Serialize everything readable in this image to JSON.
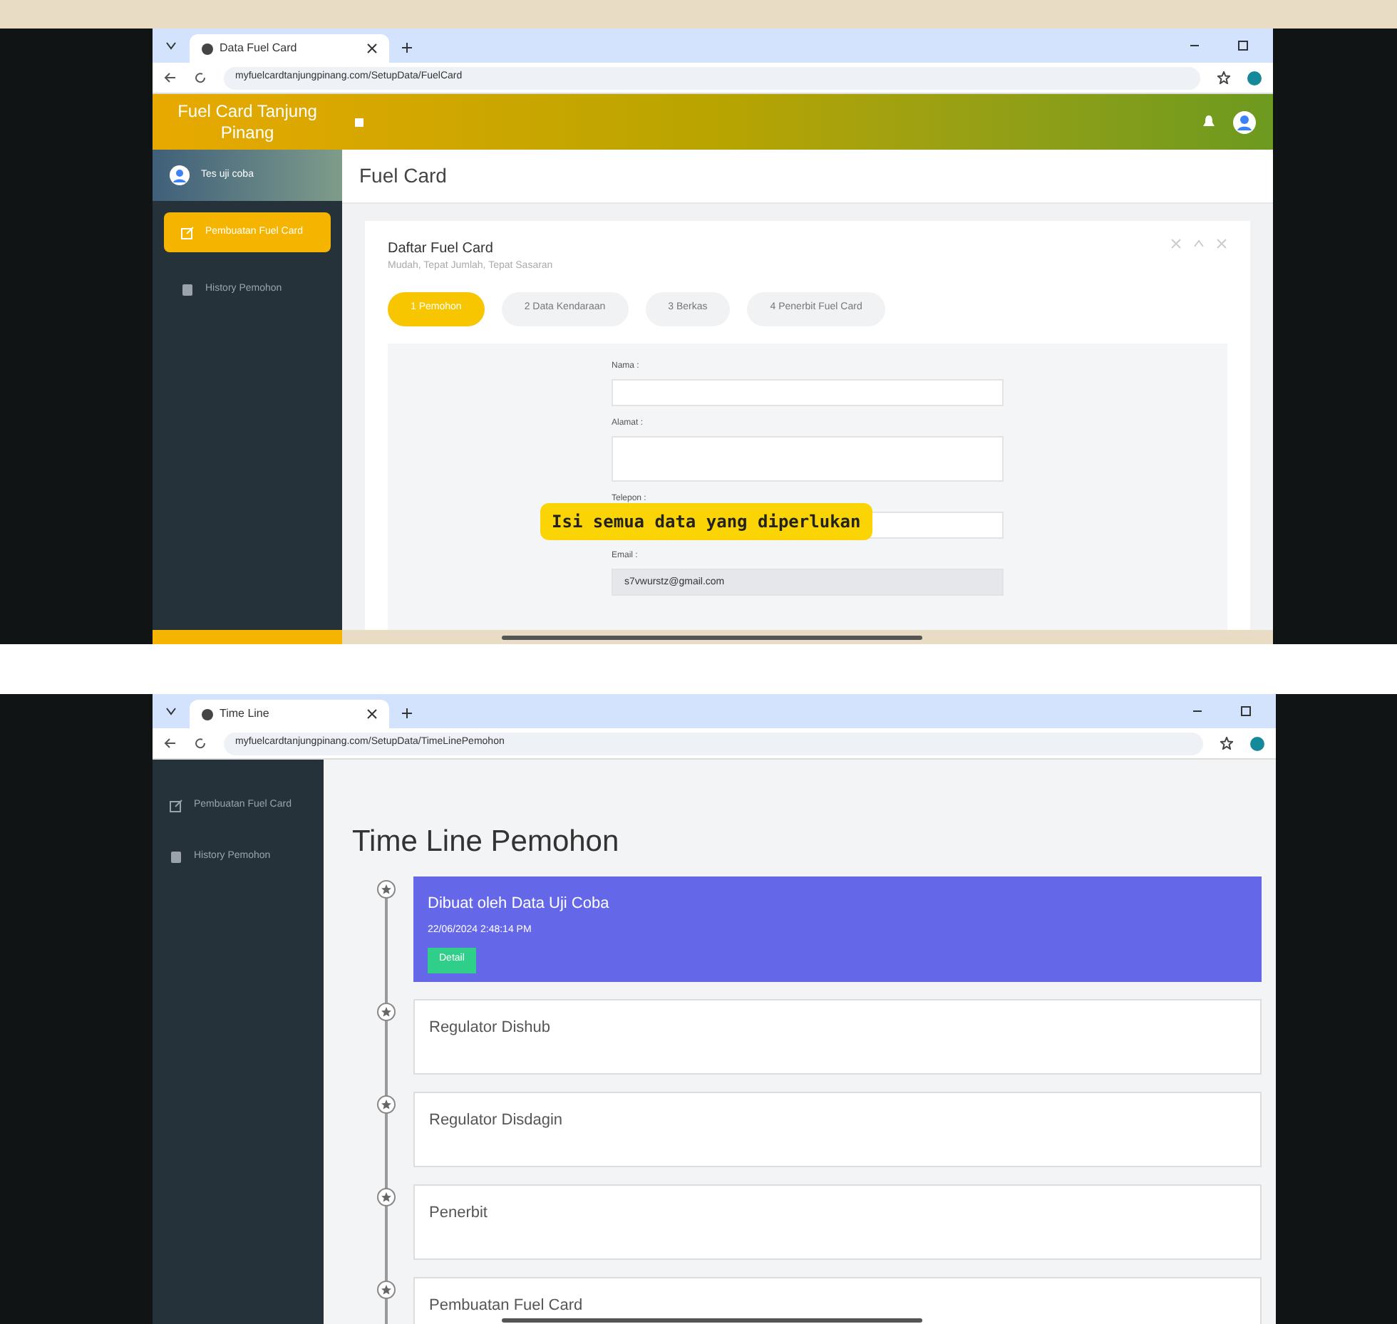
{
  "screenshots": [
    {
      "browser": {
        "tab_title": "Data Fuel Card",
        "url": "myfuelcardtanjungpinang.com/SetupData/FuelCard"
      },
      "app": {
        "brand": "Fuel Card Tanjung Pinang",
        "user": "Tes uji coba",
        "menu": [
          {
            "label": "Pembuatan Fuel Card",
            "selected": true
          },
          {
            "label": "History Pemohon",
            "selected": false
          }
        ],
        "page_title": "Fuel Card",
        "card": {
          "title": "Daftar Fuel Card",
          "subtitle": "Mudah, Tepat Jumlah, Tepat Sasaran",
          "steps": [
            {
              "label": "1 Pemohon",
              "selected": true
            },
            {
              "label": "2 Data Kendaraan",
              "selected": false
            },
            {
              "label": "3 Berkas",
              "selected": false
            },
            {
              "label": "4 Penerbit Fuel Card",
              "selected": false
            }
          ],
          "fields": [
            {
              "label": "Nama :",
              "kind": "input",
              "disabled": false
            },
            {
              "label": "Alamat :",
              "kind": "textarea",
              "disabled": false
            },
            {
              "label": "Telepon :",
              "kind": "input",
              "disabled": false
            },
            {
              "label": "Email :",
              "kind": "input",
              "value": "s7vwurstz@gmail.com",
              "disabled": true
            }
          ]
        },
        "caption": "Isi semua data yang diperlukan"
      }
    },
    {
      "browser": {
        "tab_title": "Time Line",
        "url": "myfuelcardtanjungpinang.com/SetupData/TimeLinePemohon"
      },
      "app": {
        "menu": [
          {
            "label": "Pembuatan Fuel Card",
            "selected": false
          },
          {
            "label": "History Pemohon",
            "selected": false
          }
        ],
        "heading": "Time Line Pemohon",
        "timeline": [
          {
            "title": "Dibuat oleh Data Uji Coba",
            "time": "22/06/2024 2:48:14 PM",
            "button": "Detail",
            "selected": true
          },
          {
            "title": "Regulator Dishub",
            "selected": false
          },
          {
            "title": "Regulator Disdagin",
            "selected": false
          },
          {
            "title": "Penerbit",
            "selected": false
          },
          {
            "title": "Pembuatan Fuel Card",
            "selected": false
          }
        ]
      }
    }
  ]
}
